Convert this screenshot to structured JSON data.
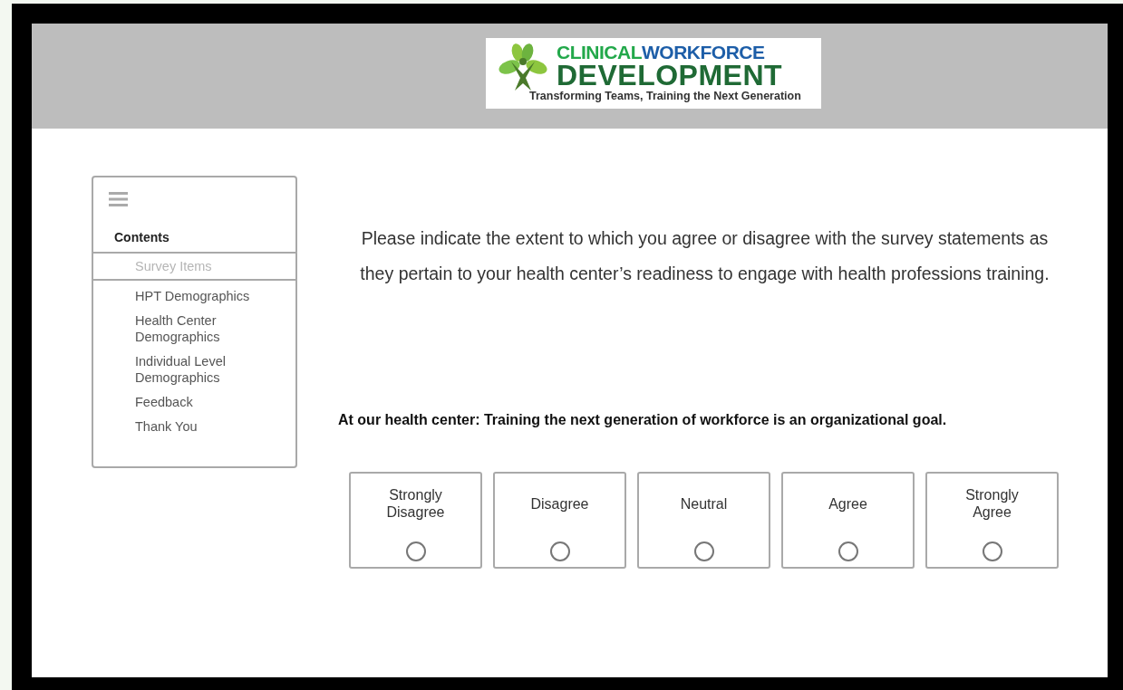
{
  "logo": {
    "title_words": [
      {
        "text": "CLINICAL",
        "color": "#22a84a"
      },
      {
        "text": "WORKFORCE",
        "color": "#1d5ea8"
      }
    ],
    "main_word": "DEVELOPMENT",
    "tagline": "Transforming Teams, Training the Next Generation"
  },
  "sidebar": {
    "heading": "Contents",
    "items": [
      {
        "label": "Survey Items",
        "selected": true
      },
      {
        "label": "HPT Demographics",
        "selected": false
      },
      {
        "label": "Health Center Demographics",
        "selected": false
      },
      {
        "label": "Individual Level Demographics",
        "selected": false
      },
      {
        "label": "Feedback",
        "selected": false
      },
      {
        "label": "Thank You",
        "selected": false
      }
    ]
  },
  "intro": "Please indicate the extent to which you agree or disagree with the survey statements as they pertain to your health center’s readiness to engage with health professions training.",
  "question": "At our health center: Training the next generation of workforce is an organizational goal.",
  "options": [
    {
      "label": "Strongly Disagree",
      "selected": false
    },
    {
      "label": "Disagree",
      "selected": false
    },
    {
      "label": "Neutral",
      "selected": false
    },
    {
      "label": "Agree",
      "selected": false
    },
    {
      "label": "Strongly Agree",
      "selected": false
    }
  ]
}
